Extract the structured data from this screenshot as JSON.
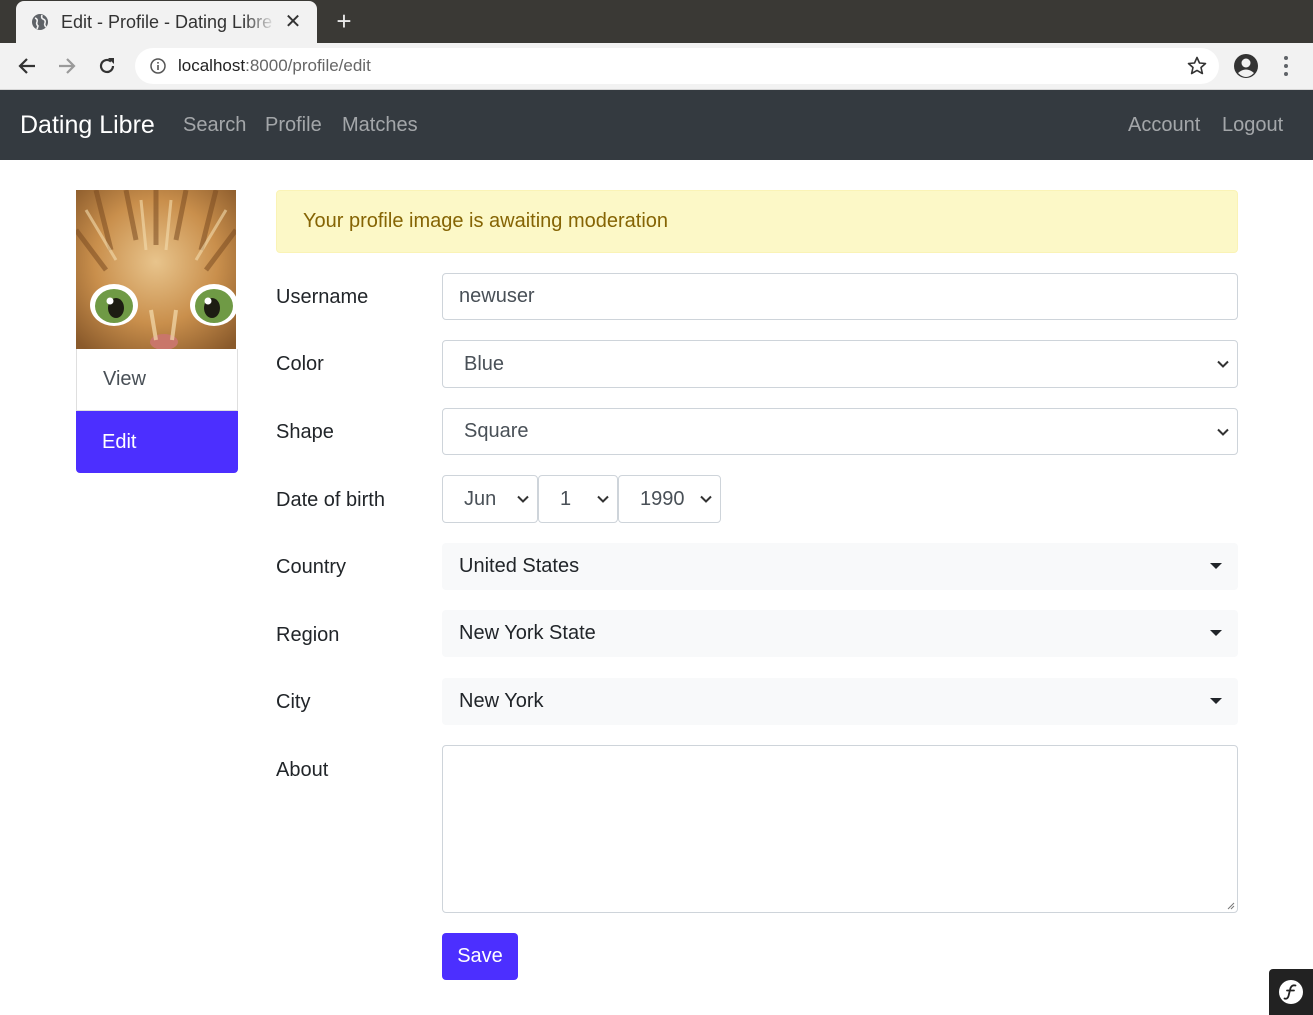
{
  "browser": {
    "tab_title": "Edit - Profile - Dating Libre",
    "url_host": "localhost",
    "url_rest": ":8000/profile/edit"
  },
  "navbar": {
    "brand": "Dating Libre",
    "left_links": [
      "Search",
      "Profile",
      "Matches"
    ],
    "right_links": [
      "Account",
      "Logout"
    ]
  },
  "sidebar": {
    "items": [
      {
        "label": "View",
        "active": false
      },
      {
        "label": "Edit",
        "active": true
      }
    ]
  },
  "alert": {
    "message": "Your profile image is awaiting moderation"
  },
  "form": {
    "username_label": "Username",
    "username_value": "newuser",
    "color_label": "Color",
    "color_value": "Blue",
    "shape_label": "Shape",
    "shape_value": "Square",
    "dob_label": "Date of birth",
    "dob_month": "Jun",
    "dob_day": "1",
    "dob_year": "1990",
    "country_label": "Country",
    "country_value": "United States",
    "region_label": "Region",
    "region_value": "New York State",
    "city_label": "City",
    "city_value": "New York",
    "about_label": "About",
    "about_value": "",
    "save_label": "Save"
  },
  "colors": {
    "accent": "#4c2fff",
    "navbar_bg": "#343a40",
    "alert_bg": "#fcf8c7",
    "alert_text": "#856404"
  }
}
